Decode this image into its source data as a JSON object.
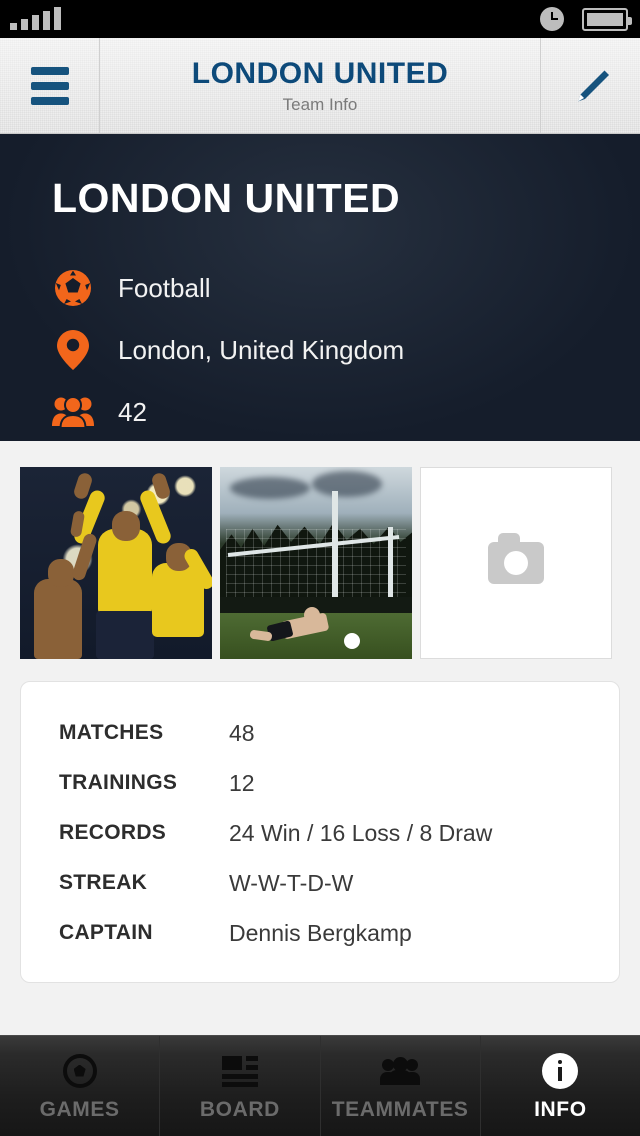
{
  "status_bar": {
    "signal_icon": "signal-bars-icon",
    "signal_bars": 5,
    "clock_icon": "clock-icon",
    "battery_icon": "battery-full-icon"
  },
  "navbar": {
    "menu_icon": "hamburger-menu-icon",
    "title": "LONDON UNITED",
    "subtitle": "Team Info",
    "edit_icon": "pencil-edit-icon"
  },
  "hero": {
    "team_name": "LONDON UNITED",
    "rows": [
      {
        "icon": "soccer-ball-icon",
        "text": "Football"
      },
      {
        "icon": "location-pin-icon",
        "text": "London, United Kingdom"
      },
      {
        "icon": "people-group-icon",
        "text": "42"
      }
    ]
  },
  "gallery": {
    "photos": [
      {
        "alt": "Players in yellow kits celebrating under stadium floodlights"
      },
      {
        "alt": "Goalkeeper diving toward the ball in front of a goal"
      }
    ],
    "add_photo": {
      "icon": "camera-icon"
    }
  },
  "stats": {
    "rows": [
      {
        "label": "MATCHES",
        "value": "48"
      },
      {
        "label": "TRAININGS",
        "value": "12"
      },
      {
        "label": "RECORDS",
        "value": "24 Win  /  16 Loss  /  8 Draw"
      },
      {
        "label": "STREAK",
        "value": "W-W-T-D-W"
      },
      {
        "label": "CAPTAIN",
        "value": "Dennis Bergkamp"
      }
    ]
  },
  "tabbar": {
    "tabs": [
      {
        "label": "GAMES",
        "icon": "soccer-ball-icon",
        "active": false
      },
      {
        "label": "BOARD",
        "icon": "board-list-icon",
        "active": false
      },
      {
        "label": "TEAMMATES",
        "icon": "people-group-icon",
        "active": false
      },
      {
        "label": "INFO",
        "icon": "info-circle-icon",
        "active": true
      }
    ]
  },
  "colors": {
    "accent_orange": "#f2661b",
    "brand_navy": "#0d4a7a",
    "hero_bg": "#151d2b",
    "page_bg": "#f2f2f2"
  }
}
